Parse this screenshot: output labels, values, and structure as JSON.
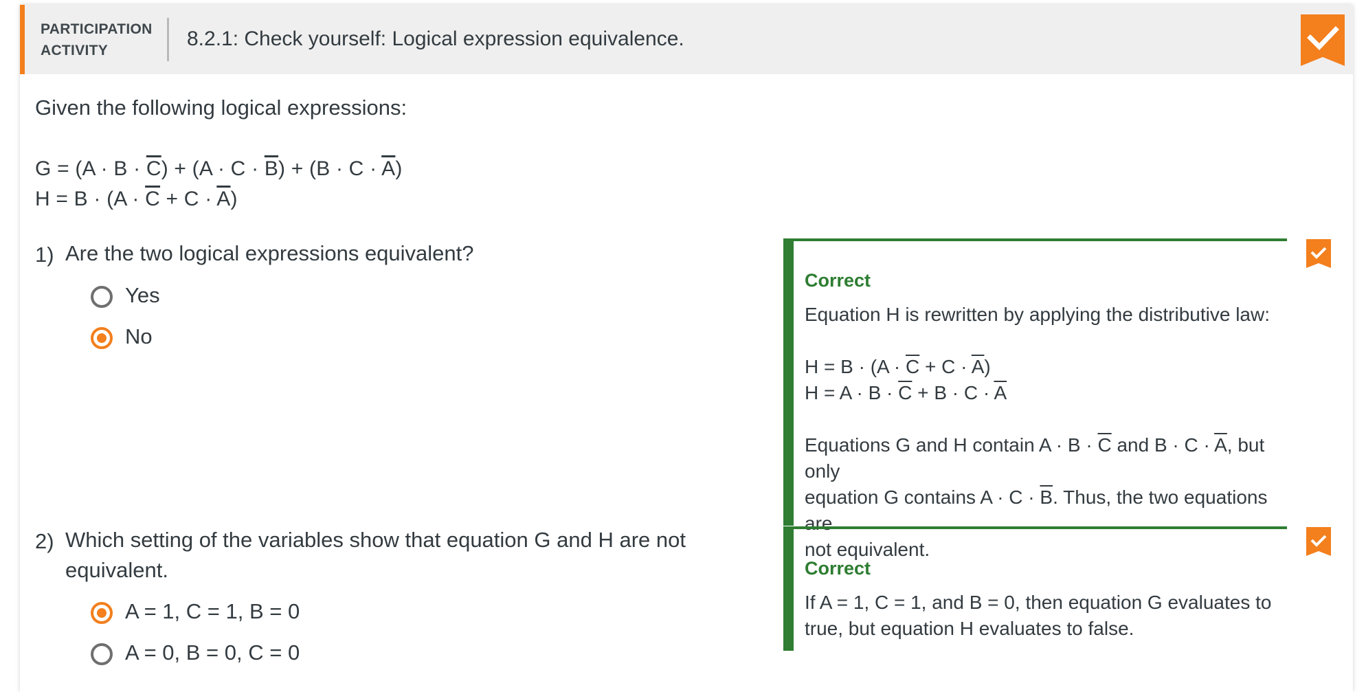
{
  "header": {
    "label_line1": "PARTICIPATION",
    "label_line2": "ACTIVITY",
    "title": "8.2.1: Check yourself: Logical expression equivalence."
  },
  "intro": "Given the following logical expressions:",
  "formula_G": {
    "p1": "G = (A · B · ",
    "o1": "C",
    "p2": ") + (A · C · ",
    "o2": "B",
    "p3": ") + (B · C · ",
    "o3": "A",
    "p4": ")"
  },
  "formula_H": {
    "p1": "H = B · (A · ",
    "o1": "C",
    "p2": " + C · ",
    "o2": "A",
    "p3": ")"
  },
  "questions": [
    {
      "number": "1)",
      "text": "Are the two logical expressions equivalent?",
      "options": [
        "Yes",
        "No"
      ],
      "selected": 1,
      "feedback": {
        "title": "Correct",
        "line1": "Equation H is rewritten by applying the distributive law:",
        "eq1": {
          "p1": "H = B · (A · ",
          "o1": "C",
          "p2": " + C · ",
          "o2": "A",
          "p3": ")"
        },
        "eq2": {
          "p1": "H = A · B · ",
          "o1": "C",
          "p2": " + B · C · ",
          "o2": "A"
        },
        "para": {
          "p1": "Equations G and H contain A · B · ",
          "o1": "C",
          "p2": " and B · C · ",
          "o2": "A",
          "p3": ", but only",
          "p4": "equation G contains A · C · ",
          "o3": "B",
          "p5": ". Thus, the two equations are",
          "p6": "not equivalent."
        }
      }
    },
    {
      "number": "2)",
      "text_line1": "Which setting of the variables show that equation G and H are not",
      "text_line2": "equivalent.",
      "options": [
        "A = 1, C = 1, B = 0",
        "A = 0, B = 0, C = 0"
      ],
      "selected": 0,
      "feedback": {
        "title": "Correct",
        "line1": "If A = 1, C = 1, and B = 0, then equation G evaluates to",
        "line2": "true, but equation H evaluates to false."
      }
    }
  ],
  "icons": {
    "header_check": "checkmark-badge-icon",
    "question_check": "checkmark-icon"
  },
  "colors": {
    "accent": "#f37f1d",
    "correct": "#2e7d32",
    "header_bg": "#efefef",
    "text": "#333b40"
  }
}
